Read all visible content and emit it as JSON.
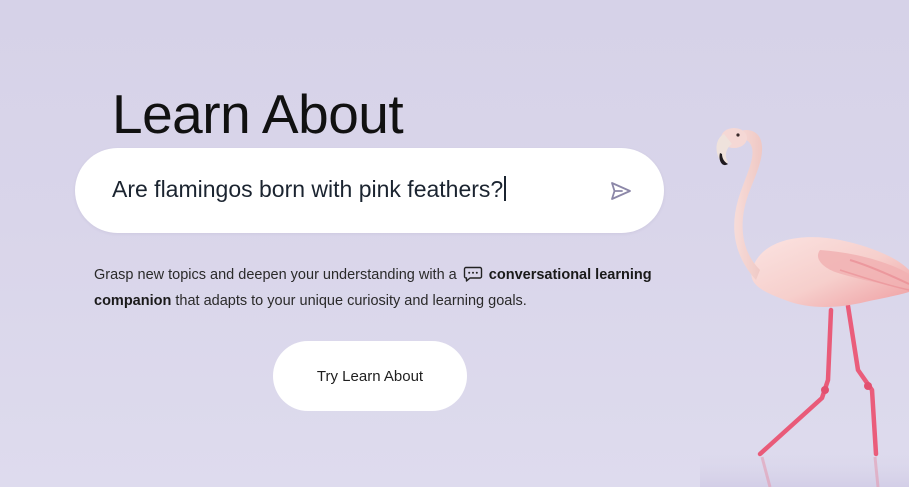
{
  "hero": {
    "title": "Learn About"
  },
  "prompt": {
    "value": "Are flamingos born with pink feathers?",
    "send_icon": "send-arrow-icon"
  },
  "description": {
    "part1": "Grasp new topics and deepen your understanding with a ",
    "chat_icon": "chat-bubble-icon",
    "bold": "conversational learning companion",
    "part2": " that adapts to your unique curiosity and learning goals."
  },
  "cta": {
    "label": "Try Learn About"
  },
  "illustration": {
    "icon": "flamingo-photo"
  },
  "colors": {
    "background": "#d8d4ea",
    "card": "#ffffff",
    "text": "#111111",
    "flamingo": "#f3c4c2",
    "legs": "#e95b79"
  }
}
